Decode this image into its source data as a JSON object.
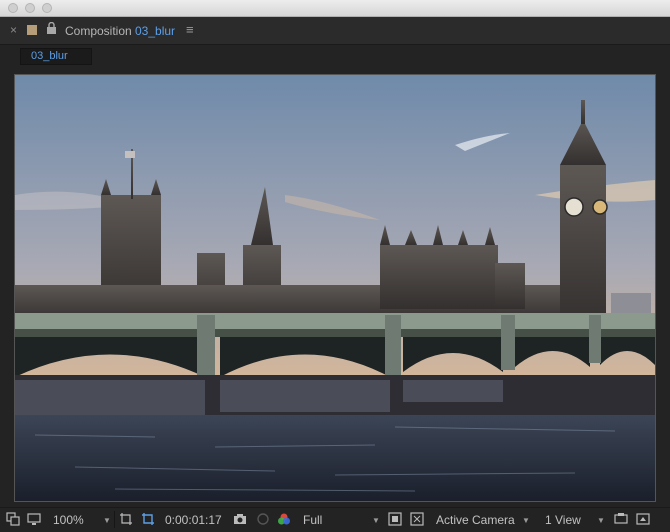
{
  "panel": {
    "close_glyph": "×",
    "title_label": "Composition",
    "comp_name": "03_blur",
    "menu_glyph": "≡",
    "subtab_label": "03_blur"
  },
  "viewer": {
    "image_subject": "Westminster Palace and Big Ben with bridge over River Thames, HDR edge-enhanced"
  },
  "footer": {
    "zoom": "100%",
    "timecode": "0:00:01:17",
    "resolution": "Full",
    "camera": "Active Camera",
    "views": "1 View"
  },
  "colors": {
    "accent_blue": "#5e9fe6",
    "panel_bg": "#232323",
    "swatch": "#b49d78"
  }
}
